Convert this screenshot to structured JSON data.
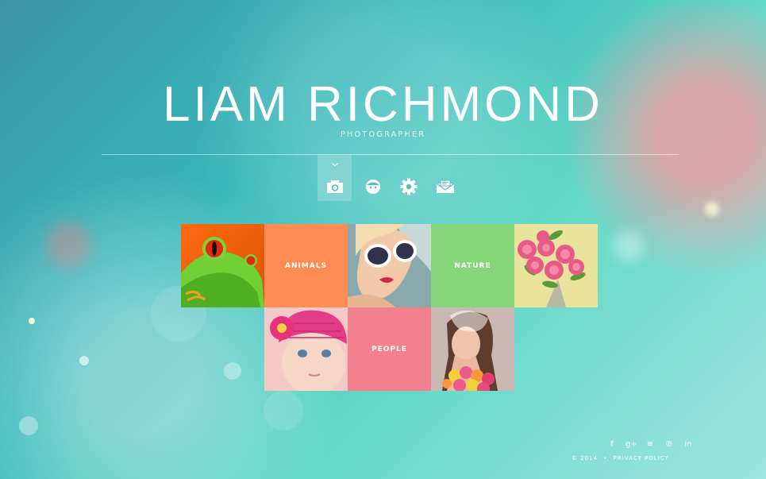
{
  "header": {
    "title": "LIAM RICHMOND",
    "subtitle": "PHOTOGRAPHER"
  },
  "nav": {
    "items": [
      {
        "icon": "camera-icon",
        "active": true
      },
      {
        "icon": "smiley-icon",
        "active": false
      },
      {
        "icon": "gear-icon",
        "active": false
      },
      {
        "icon": "envelope-icon",
        "active": false
      }
    ]
  },
  "gallery": {
    "categories": [
      {
        "label": "ANIMALS",
        "color": "#fe8c54"
      },
      {
        "label": "NATURE",
        "color": "#84d679"
      },
      {
        "label": "PEOPLE",
        "color": "#f2808e"
      }
    ]
  },
  "footer": {
    "social_icons": [
      "facebook-icon",
      "google-plus-icon",
      "rss-icon",
      "pinterest-icon",
      "linkedin-icon"
    ],
    "social_glyphs": [
      "f",
      "g+",
      "≡",
      "℗",
      "in"
    ],
    "copyright": "© 2014",
    "separator": "•",
    "privacy_policy": "PRIVACY POLICY"
  }
}
